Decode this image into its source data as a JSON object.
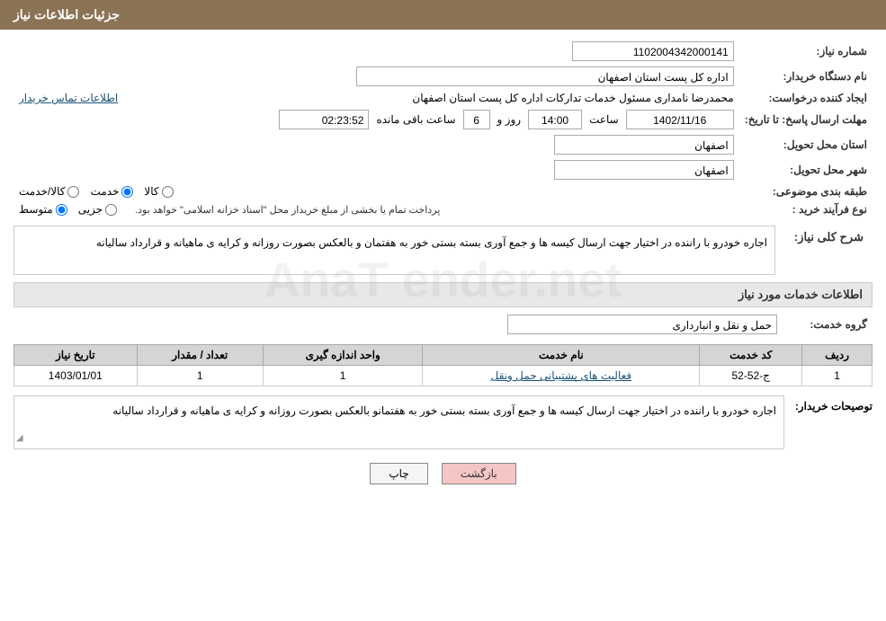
{
  "header": {
    "title": "جزئیات اطلاعات نیاز"
  },
  "fields": {
    "shomara_niaz_label": "شماره نیاز:",
    "shomara_niaz_value": "1102004342000141",
    "nam_dastgah_label": "نام دستگاه خریدار:",
    "nam_dastgah_value": "اداره کل پست استان اصفهان",
    "ijad_konande_label": "ایجاد کننده درخواست:",
    "ijad_konande_value": "محمدرضا نامداری مسئول خدمات تداركات اداره كل پست استان اصفهان",
    "ettelaat_tamas_link": "اطلاعات تماس خریدار",
    "mohlet_label": "مهلت ارسال پاسخ: تا تاریخ:",
    "mohlet_date": "1402/11/16",
    "mohlet_saat_label": "ساعت",
    "mohlet_saat_value": "14:00",
    "mohlet_rooz_label": "روز و",
    "mohlet_rooz_value": "6",
    "mohlet_saat2_label": "ساعت باقی مانده",
    "mohlet_saat2_value": "02:23:52",
    "ostan_tahvil_label": "استان محل تحویل:",
    "ostan_tahvil_value": "اصفهان",
    "shahr_tahvil_label": "شهر محل تحویل:",
    "shahr_tahvil_value": "اصفهان",
    "tabaqe_label": "طبقه بندی موضوعی:",
    "tabaqe_kala": "کالا",
    "tabaqe_khedmat": "خدمت",
    "tabaqe_kala_khedmat": "کالا/خدمت",
    "tabaqe_selected": "khedmat",
    "nooe_farayand_label": "نوع فرآیند خرید :",
    "nooe_jozii": "جزیی",
    "nooe_motavasset": "متوسط",
    "nooe_selected": "motavasset",
    "nooe_description": "پرداخت تمام یا بخشی از مبلغ خریداز محل \"اسناد خزانه اسلامی\" خواهد بود.",
    "sharh_section_title": "شرح کلی نیاز:",
    "sharh_value": "اجاره خودرو با راننده در اختیار جهت ارسال کیسه ها و جمع آوری بسته بستی خور به هفتمان و بالعکس بصورت روزانه و کرایه ی ماهیانه و قرارداد سالیانه",
    "khadamat_section_title": "اطلاعات خدمات مورد نیاز",
    "goroh_khedmat_label": "گروه خدمت:",
    "goroh_khedmat_value": "حمل و نقل و انبارداری",
    "table_headers": {
      "radif": "ردیف",
      "kod_khedmat": "کد خدمت",
      "name_khedmat": "نام خدمت",
      "vahed_andaze": "واحد اندازه گیری",
      "tedad_megdar": "تعداد / مقدار",
      "tarikh_niaz": "تاریخ نیاز"
    },
    "table_rows": [
      {
        "radif": "1",
        "kod_khedmat": "ج-52-52",
        "name_khedmat": "فعالیت های پشتیبانی حمل ونقل",
        "vahed_andaze": "1",
        "tedad_megdar": "1",
        "tarikh_niaz": "1403/01/01"
      }
    ],
    "tosifat_label": "توصیحات خریدار:",
    "tosifat_value": "اجاره خودرو با راننده در اختیار جهت ارسال کیسه ها و جمع آوری بسته بستی خور به هفتمانو بالعکس بصورت روزانه و کرایه ی ماهیانه و قرارداد سالیانه",
    "btn_back": "بازگشت",
    "btn_print": "چاپ"
  },
  "watermark": "AnaT ender.net"
}
